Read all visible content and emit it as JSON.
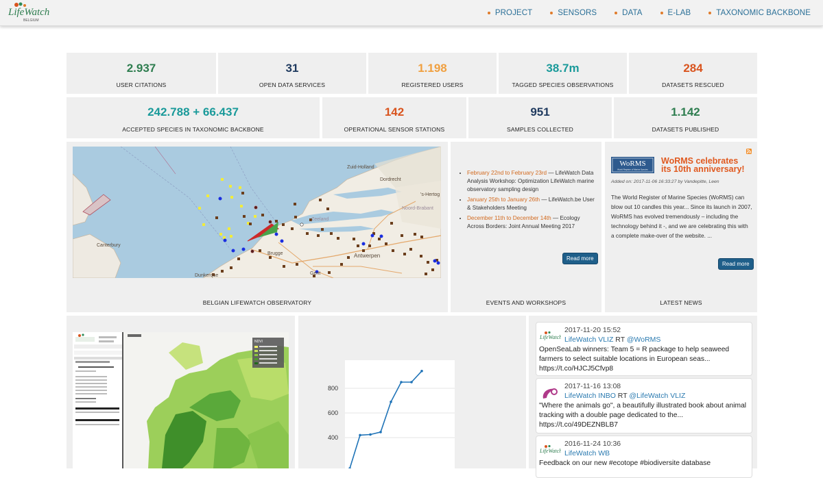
{
  "header": {
    "logo_text": "LifeWatch",
    "logo_sub": "BELGIUM",
    "nav": [
      {
        "label": "PROJECT"
      },
      {
        "label": "SENSORS"
      },
      {
        "label": "DATA"
      },
      {
        "label": "E-LAB"
      },
      {
        "label": "TAXONOMIC BACKBONE"
      }
    ]
  },
  "stats_row1": [
    {
      "value": "2.937",
      "label": "USER CITATIONS",
      "color": "#2e7d4f"
    },
    {
      "value": "31",
      "label": "OPEN DATA SERVICES",
      "color": "#1f3a5f"
    },
    {
      "value": "1.198",
      "label": "REGISTERED USERS",
      "color": "#f0a040"
    },
    {
      "value": "38.7m",
      "label": "TAGGED SPECIES OBSERVATIONS",
      "color": "#1a9a9a"
    },
    {
      "value": "284",
      "label": "DATASETS RESCUED",
      "color": "#d9541e"
    }
  ],
  "stats_row2": [
    {
      "value": "242.788 + 66.437",
      "label": "ACCEPTED SPECIES IN TAXONOMIC BACKBONE",
      "color": "#1a9a9a"
    },
    {
      "value": "142",
      "label": "OPERATIONAL SENSOR STATIONS",
      "color": "#d9541e"
    },
    {
      "value": "951",
      "label": "SAMPLES COLLECTED",
      "color": "#1f3a5f"
    },
    {
      "value": "1.142",
      "label": "DATASETS PUBLISHED",
      "color": "#2e7d4f"
    }
  ],
  "observatory": {
    "label": "BELGIAN LIFEWATCH OBSERVATORY",
    "map_labels": {
      "zuid_holland": "Zuid-Holland",
      "dordrecht": "Dordrecht",
      "hertogenbosch": "'s-Hertog",
      "noord_brabant": "Noord-Brabant",
      "zeeland": "Zeeland",
      "canterbury": "Canterbury",
      "dunkerque": "Dunkerque",
      "brugge": "Brugge",
      "antwerpen": "Antwerpen",
      "gent": "Gent"
    }
  },
  "events": {
    "label": "EVENTS AND WORKSHOPS",
    "items": [
      {
        "date": "February 22nd to February 23rd",
        "text": " — LifeWatch Data Analysis Workshop: Optimization LifeWatch marine observatory sampling design"
      },
      {
        "date": "January 25th to January 26th",
        "text": " — LifeWatch.be User & Stakeholders Meeting"
      },
      {
        "date": "December 11th to December 14th",
        "text": " — Ecology Across Borders: Joint Annual Meeting 2017"
      }
    ],
    "read_more": "Read more"
  },
  "news": {
    "label": "LATEST NEWS",
    "logo_text": "WoRMS",
    "logo_sub": "World Register of Marine Species",
    "title": "WoRMS celebrates its 10th anniversary!",
    "meta": "Added on: 2017-11-06 16:33:27 by Vandepitte, Leen",
    "body": "The World Register of Marine Species (WoRMS) can blow out 10 candles this year... Since its launch in 2007, WoRMS has evolved tremendously – including the technology behind it -, and we are celebrating this with a complete make-over of the website. ...",
    "read_more": "Read more"
  },
  "portal": {
    "legend_title": "NDVI"
  },
  "chart_data": {
    "type": "line",
    "title": "",
    "xlabel": "",
    "ylabel": "",
    "yticks": [
      "800",
      "600",
      "400"
    ],
    "ylim": [
      150,
      1000
    ],
    "values": [
      150,
      420,
      425,
      445,
      690,
      850,
      850,
      940
    ]
  },
  "tweets": [
    {
      "date": "2017-11-20 15:52",
      "user": "LifeWatch VLIZ",
      "rt": " RT ",
      "handle": "@WoRMS",
      "text": "OpenSeaLab winners: Team 5 = R package to help seaweed farmers to select suitable locations in European seas...",
      "link": "https://t.co/HJCJ5Cfvp8"
    },
    {
      "date": "2017-11-16 13:08",
      "user": "LifeWatch INBO",
      "rt": " RT ",
      "handle": "@LifeWatch VLIZ",
      "text": "\"Where the animals go\", a beautifully illustrated book about animal tracking with a double page dedicated to the...",
      "link": "https://t.co/49DEZNBLB7"
    },
    {
      "date": "2016-11-24 10:36",
      "user": "LifeWatch WB",
      "rt": "",
      "handle": "",
      "text": "Feedback on our new #ecotope #biodiversite database",
      "link": ""
    }
  ]
}
